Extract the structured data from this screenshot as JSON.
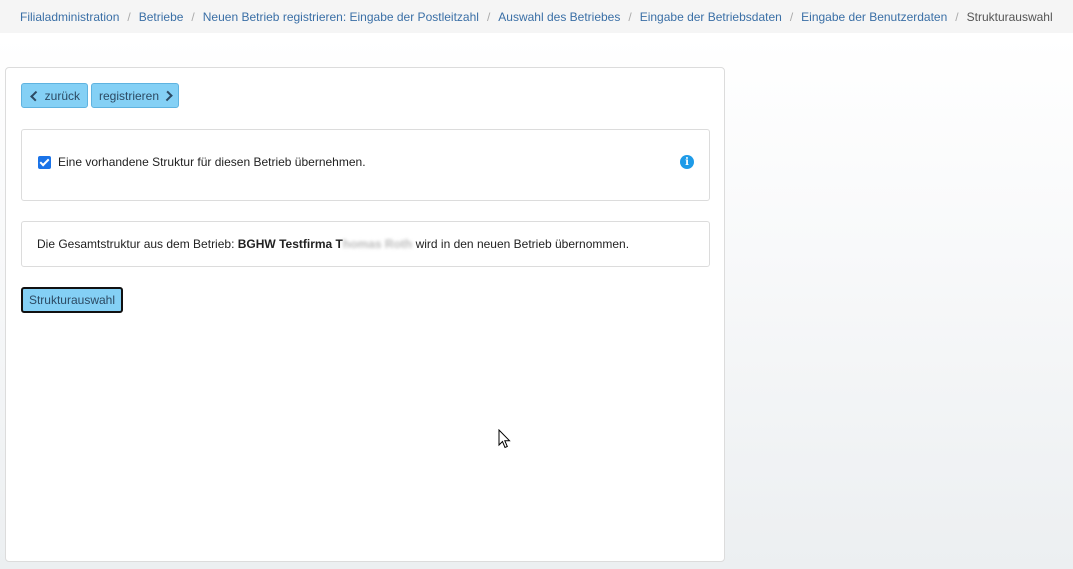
{
  "breadcrumb": {
    "items": [
      "Filialadministration",
      "Betriebe",
      "Neuen Betrieb registrieren: Eingabe der Postleitzahl",
      "Auswahl des Betriebes",
      "Eingabe der Betriebsdaten",
      "Eingabe der Benutzerdaten"
    ],
    "active": "Strukturauswahl",
    "separator": "/"
  },
  "toolbar": {
    "back_label": "zurück",
    "register_label": "registrieren"
  },
  "structure_option": {
    "checked": true,
    "label": "Eine vorhandene Struktur für diesen Betrieb übernehmen.",
    "info_icon": "info-icon"
  },
  "summary": {
    "prefix": "Die Gesamtstruktur aus dem Betrieb:",
    "company_bold": "BGHW Testfirma T",
    "company_redacted": "homas Roth",
    "suffix": "wird in den neuen Betrieb übernommen."
  },
  "struct_button_label": "Strukturauswahl",
  "colors": {
    "button_bg": "#84d0f5",
    "link": "#3a6fa6",
    "checkbox": "#1a73e8",
    "info": "#1e9be8"
  }
}
